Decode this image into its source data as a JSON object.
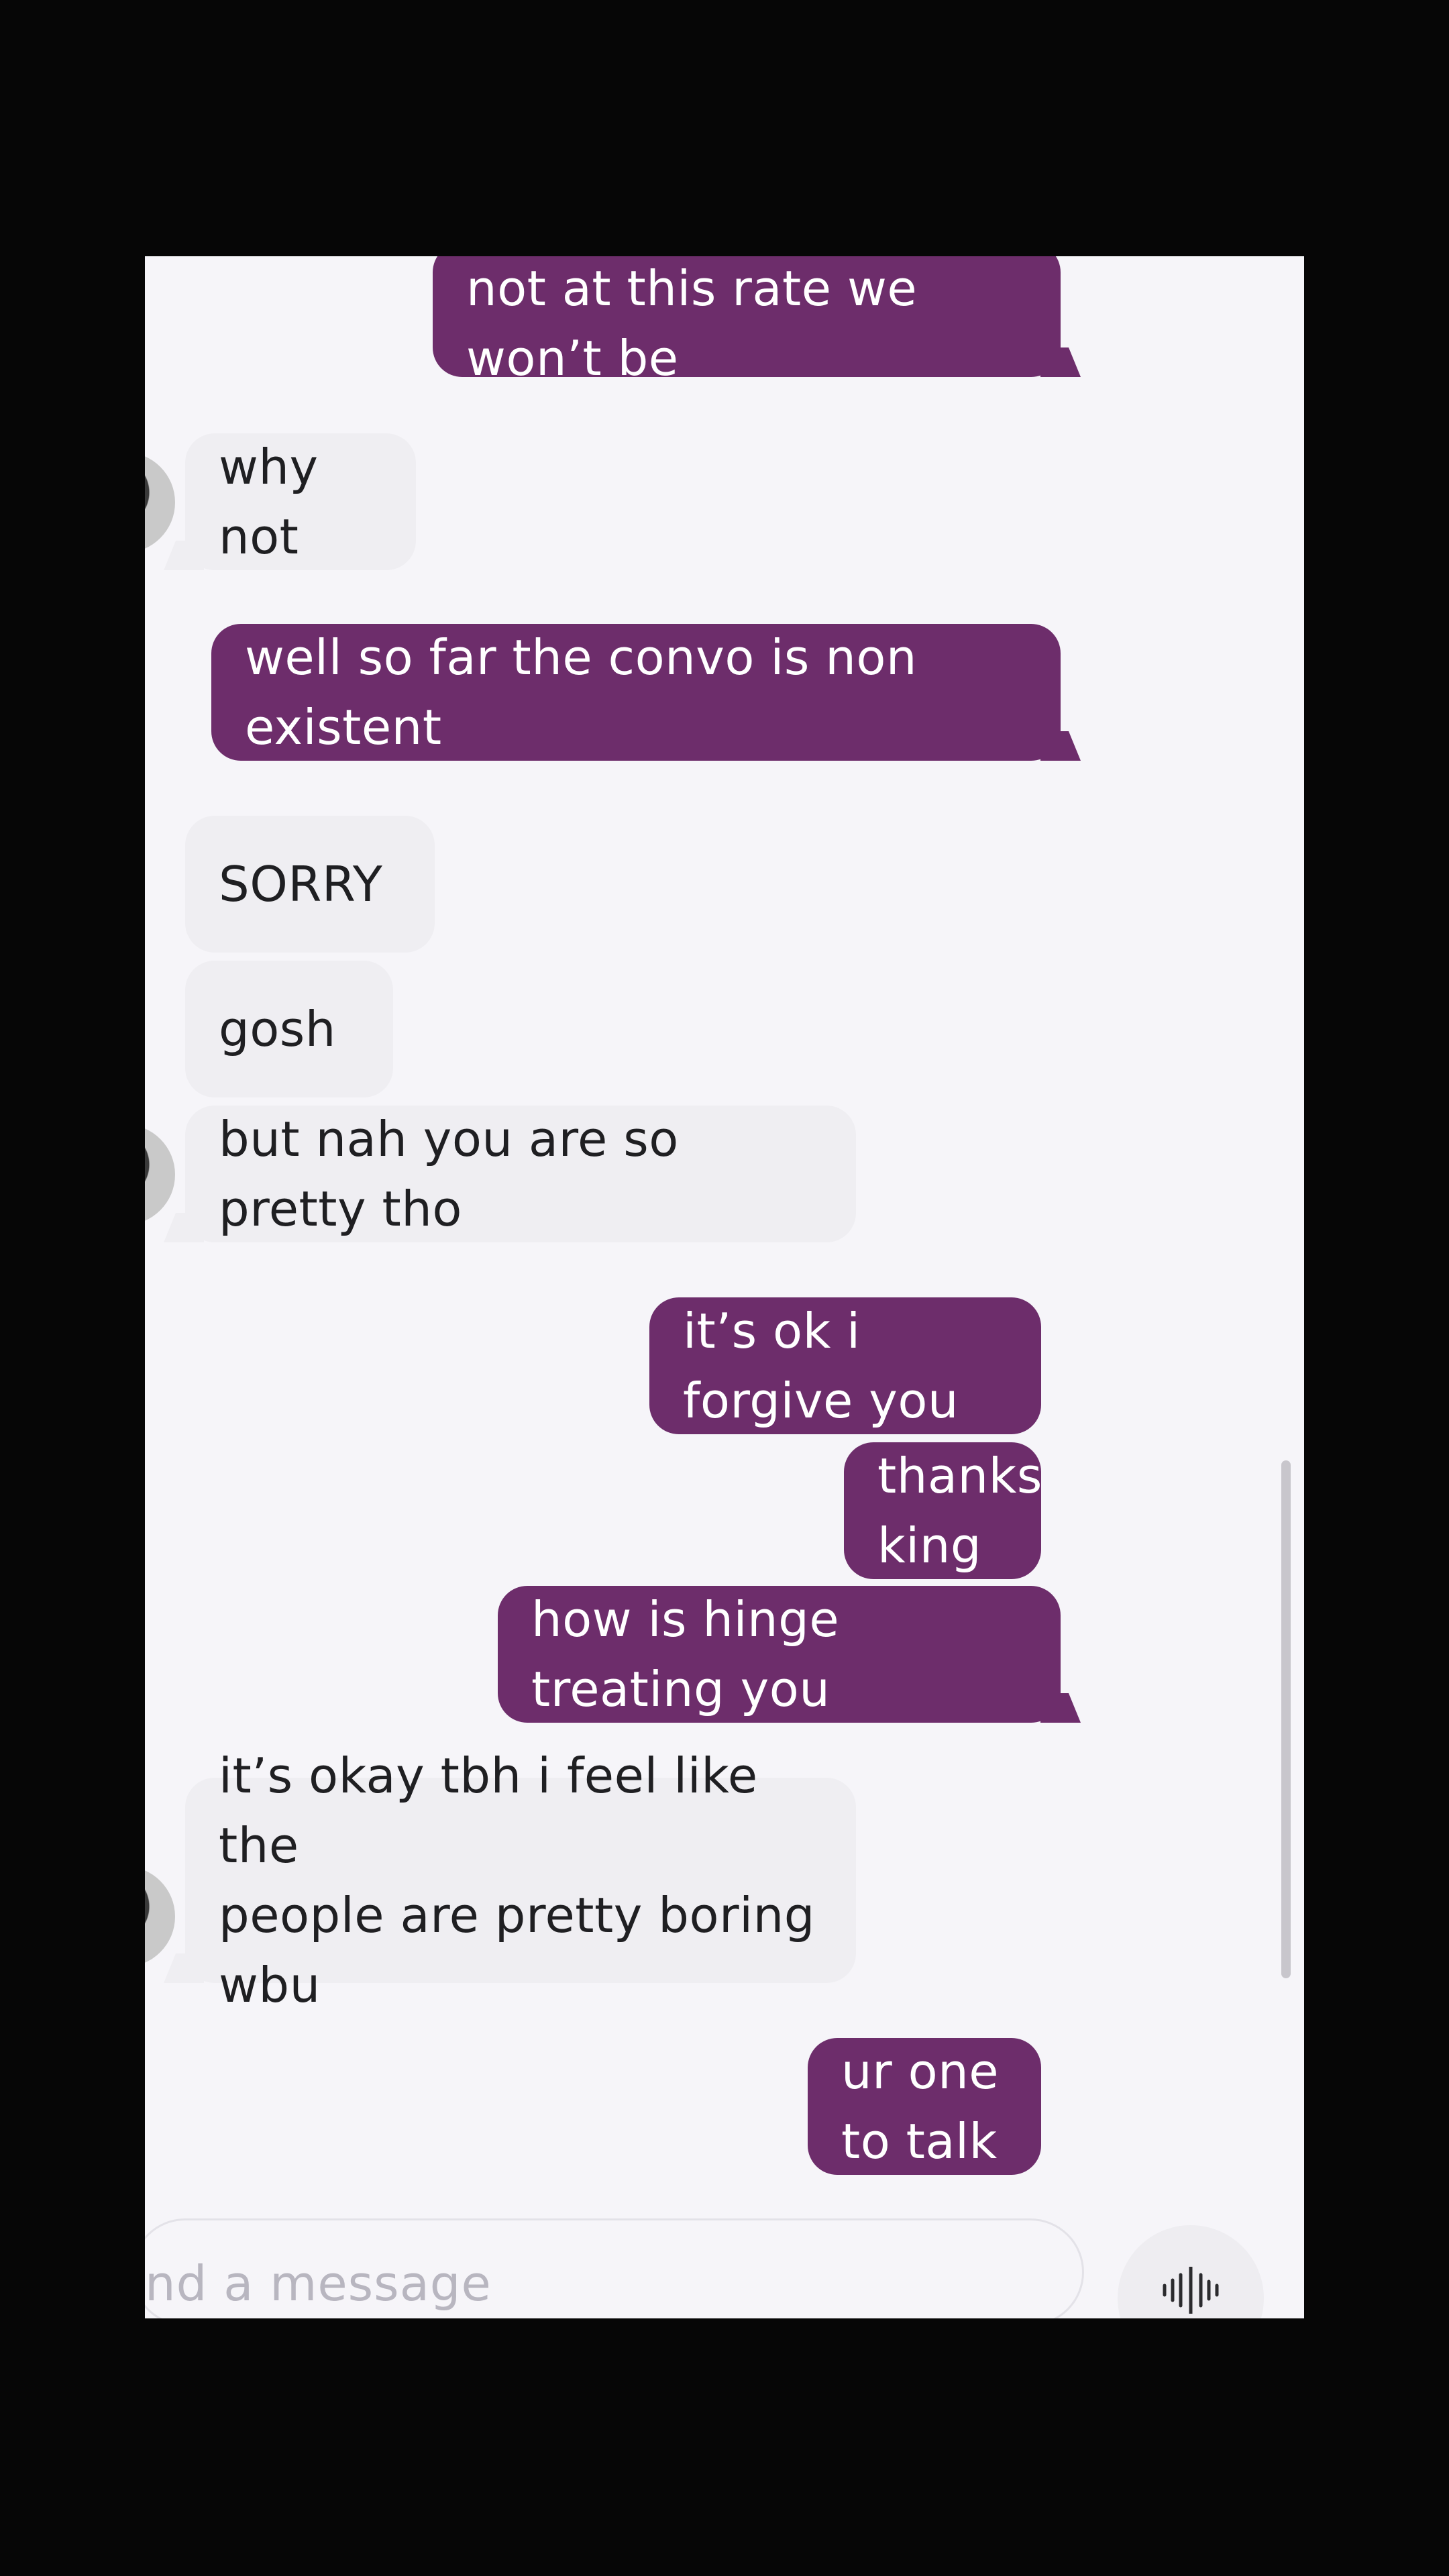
{
  "messages": [
    {
      "side": "out",
      "text": "not at this rate we won’t be"
    },
    {
      "side": "in",
      "text": "why not"
    },
    {
      "side": "out",
      "text": "well so far the convo is non existent"
    },
    {
      "side": "in",
      "text": "SORRY"
    },
    {
      "side": "in",
      "text": "gosh"
    },
    {
      "side": "in",
      "text": "but nah you are so pretty tho"
    },
    {
      "side": "out",
      "text": "it’s ok i forgive you"
    },
    {
      "side": "out",
      "text": "thanks king"
    },
    {
      "side": "out",
      "text": "how is hinge treating you"
    },
    {
      "side": "in",
      "text": "it’s okay tbh i feel like the\npeople are pretty boring wbu"
    },
    {
      "side": "out",
      "text": "ur one to talk"
    }
  ],
  "composer": {
    "placeholder_visible": "nd a message"
  },
  "colors": {
    "outgoing_bubble": "#6d2d6b",
    "incoming_bubble": "#efeef2",
    "background": "#f6f5f9"
  },
  "icons": {
    "voice": "waveform-icon"
  }
}
